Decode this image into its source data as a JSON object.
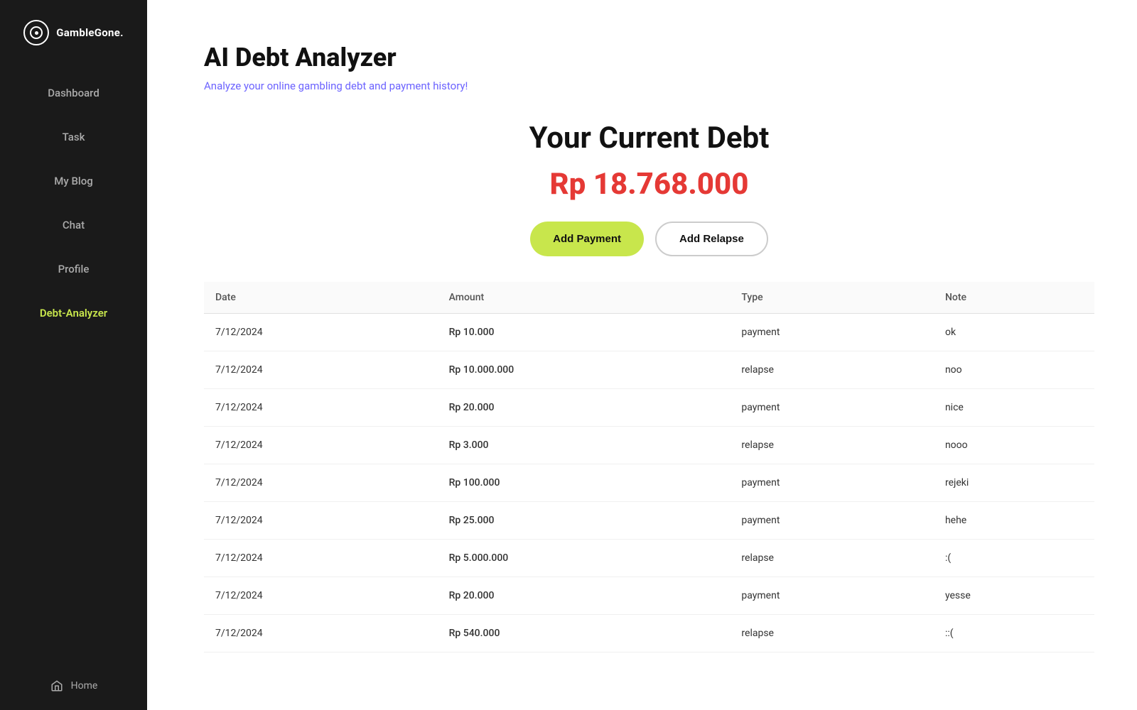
{
  "app": {
    "logo_text": "GambleGone.",
    "logo_icon": "◎"
  },
  "sidebar": {
    "items": [
      {
        "id": "dashboard",
        "label": "Dashboard",
        "active": false
      },
      {
        "id": "task",
        "label": "Task",
        "active": false
      },
      {
        "id": "my-blog",
        "label": "My Blog",
        "active": false
      },
      {
        "id": "chat",
        "label": "Chat",
        "active": false
      },
      {
        "id": "profile",
        "label": "Profile",
        "active": false
      },
      {
        "id": "debt-analyzer",
        "label": "Debt-Analyzer",
        "active": true
      }
    ],
    "home_label": "Home"
  },
  "main": {
    "title": "AI Debt Analyzer",
    "subtitle": "Analyze your online gambling debt and payment history!",
    "debt_label": "Your Current Debt",
    "debt_amount": "Rp 18.768.000",
    "btn_add_payment": "Add Payment",
    "btn_add_relapse": "Add Relapse",
    "table": {
      "headers": [
        "Date",
        "Amount",
        "Type",
        "Note"
      ],
      "rows": [
        {
          "date": "7/12/2024",
          "amount": "Rp 10.000",
          "type": "payment",
          "note": "ok"
        },
        {
          "date": "7/12/2024",
          "amount": "Rp 10.000.000",
          "type": "relapse",
          "note": "noo"
        },
        {
          "date": "7/12/2024",
          "amount": "Rp 20.000",
          "type": "payment",
          "note": "nice"
        },
        {
          "date": "7/12/2024",
          "amount": "Rp 3.000",
          "type": "relapse",
          "note": "nooo"
        },
        {
          "date": "7/12/2024",
          "amount": "Rp 100.000",
          "type": "payment",
          "note": "rejeki"
        },
        {
          "date": "7/12/2024",
          "amount": "Rp 25.000",
          "type": "payment",
          "note": "hehe"
        },
        {
          "date": "7/12/2024",
          "amount": "Rp 5.000.000",
          "type": "relapse",
          "note": ":("
        },
        {
          "date": "7/12/2024",
          "amount": "Rp 20.000",
          "type": "payment",
          "note": "yesse"
        },
        {
          "date": "7/12/2024",
          "amount": "Rp 540.000",
          "type": "relapse",
          "note": "::("
        }
      ]
    }
  }
}
